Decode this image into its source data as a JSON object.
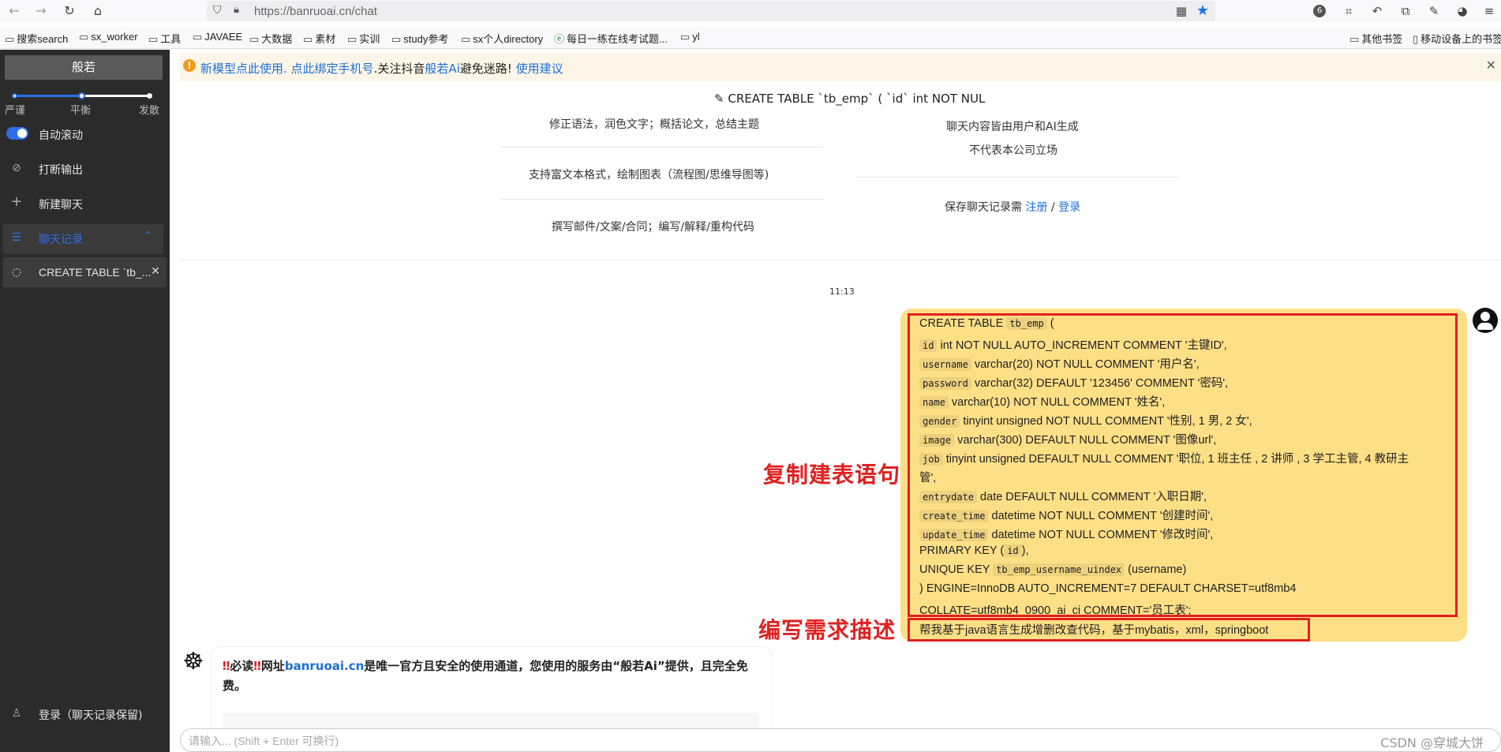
{
  "browser": {
    "url": "https://banruoai.cn/chat",
    "ext_badge": "6",
    "bookmarks": [
      "搜索search",
      "sx_worker",
      "工具",
      "JAVAEE",
      "大数据",
      "素材",
      "实训",
      "study参考",
      "sx个人directory",
      "每日一练在线考试题...",
      "yl"
    ],
    "bookmarks_right": [
      "其他书签",
      "移动设备上的书签"
    ]
  },
  "sidebar": {
    "brand": "般若",
    "slider_labels": [
      "严谨",
      "平衡",
      "发散"
    ],
    "slider_level": 0.5,
    "auto_scroll": "自动滚动",
    "interrupt": "打断输出",
    "new_chat": "新建聊天",
    "history": "聊天记录",
    "chat_item": "CREATE TABLE `tb_...",
    "login": "登录（聊天记录保留)"
  },
  "notice": {
    "part1": "新模型点此使用.",
    "part2": " 点此绑定手机号",
    "part3": ".关注抖音",
    "part4": "般若Ai",
    "part5": "避免迷路!",
    "part6": " 使用建议"
  },
  "chat": {
    "title": "CREATE TABLE `tb_emp` ( `id` int NOT NUL",
    "features_left": [
      "修正语法，润色文字；概括论文，总结主题",
      "支持富文本格式，绘制图表（流程图/思维导图等)",
      "撰写邮件/文案/合同；编写/解释/重构代码"
    ],
    "disclaimer_line1": "聊天内容皆由用户和AI生成",
    "disclaimer_line2": "不代表本公司立场",
    "save_prefix": "保存聊天记录需 ",
    "register": "注册",
    "slash": " / ",
    "login": "登录",
    "time": "11:13"
  },
  "message": {
    "lines": [
      {
        "pre": "CREATE TABLE ",
        "code": "tb_emp",
        "post": " ("
      },
      {
        "pre": "",
        "code": "id",
        "post": " int NOT NULL AUTO_INCREMENT COMMENT '主键ID',"
      },
      {
        "pre": "",
        "code": "username",
        "post": " varchar(20) NOT NULL COMMENT '用户名',"
      },
      {
        "pre": "",
        "code": "password",
        "post": " varchar(32) DEFAULT '123456' COMMENT '密码',"
      },
      {
        "pre": "",
        "code": "name",
        "post": " varchar(10) NOT NULL COMMENT '姓名',"
      },
      {
        "pre": "",
        "code": "gender",
        "post": " tinyint unsigned NOT NULL COMMENT '性别, 1 男, 2 女',"
      },
      {
        "pre": "",
        "code": "image",
        "post": " varchar(300) DEFAULT NULL COMMENT '图像url',"
      },
      {
        "pre": "",
        "code": "job",
        "post": " tinyint unsigned DEFAULT NULL COMMENT '职位, 1 班主任 , 2 讲师 , 3 学工主管, 4 教研主"
      },
      {
        "pre": "管',",
        "code": "",
        "post": ""
      },
      {
        "pre": "",
        "code": "entrydate",
        "post": " date DEFAULT NULL COMMENT '入职日期',"
      },
      {
        "pre": "",
        "code": "create_time",
        "post": " datetime NOT NULL COMMENT '创建时间',"
      },
      {
        "pre": "",
        "code": "update_time",
        "post": " datetime NOT NULL COMMENT '修改时间',"
      },
      {
        "pre": "PRIMARY KEY (",
        "code": "id",
        "post": "),"
      },
      {
        "pre": "UNIQUE KEY ",
        "code": "tb_emp_username_uindex",
        "post": " (username)"
      },
      {
        "pre": ") ENGINE=InnoDB AUTO_INCREMENT=7 DEFAULT CHARSET=utf8mb4",
        "code": "",
        "post": ""
      },
      {
        "pre": "COLLATE=utf8mb4_0900_ai_ci COMMENT='员工表';",
        "code": "",
        "post": ""
      }
    ],
    "request": "帮我基于java语言生成增删改查代码，基于mybatis，xml，springboot"
  },
  "annotations": {
    "copy": "复制建表语句",
    "write": "编写需求描述"
  },
  "bot": {
    "mark": "‼",
    "read": "必读",
    "text1": "网址",
    "link": "banruoai.cn",
    "text2": "是唯一官方且安全的使用通道，您使用的服务由“般若Ai”提供，且完全免费。"
  },
  "input": {
    "placeholder": "请输入... (Shift + Enter 可换行)"
  },
  "watermark": "CSDN @穿城大饼"
}
